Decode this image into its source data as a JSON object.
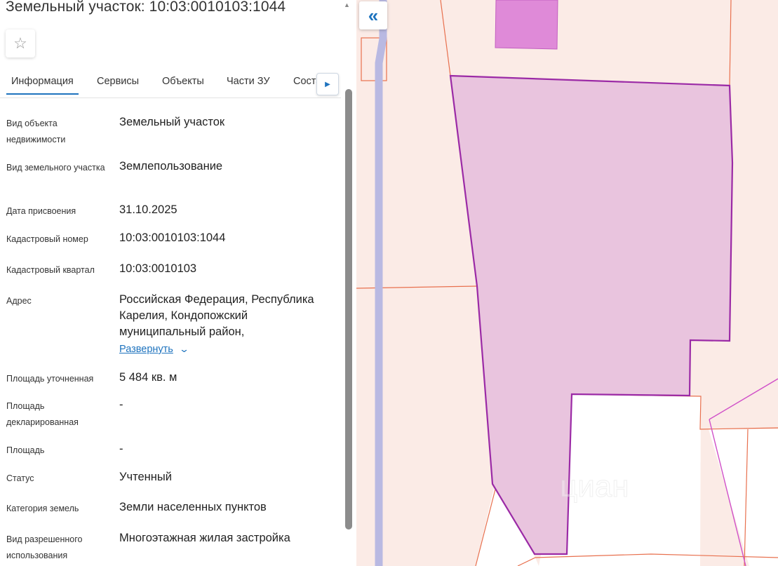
{
  "header": {
    "title": "Земельный участок: 10:03:0010103:1044"
  },
  "tabs": [
    {
      "label": "Информация",
      "active": true
    },
    {
      "label": "Сервисы"
    },
    {
      "label": "Объекты"
    },
    {
      "label": "Части ЗУ"
    },
    {
      "label": "Состав"
    }
  ],
  "fields": [
    {
      "label": "Вид объекта недвижимости",
      "value": "Земельный участок"
    },
    {
      "label": "Вид земельного участка",
      "value": "Землепользование"
    },
    {
      "label": "Дата присвоения",
      "value": "31.10.2025"
    },
    {
      "label": "Кадастровый номер",
      "value": "10:03:0010103:1044"
    },
    {
      "label": "Кадастровый квартал",
      "value": "10:03:0010103"
    },
    {
      "label": "Адрес",
      "value": "Российская Федерация, Республика Карелия, Кондопожский муниципальный район,"
    },
    {
      "label": "Площадь уточненная",
      "value": "5 484 кв. м"
    },
    {
      "label": "Площадь декларированная",
      "value": "-"
    },
    {
      "label": "Площадь",
      "value": "-"
    },
    {
      "label": "Статус",
      "value": "Учтенный"
    },
    {
      "label": "Категория земель",
      "value": "Земли населенных пунктов"
    },
    {
      "label": "Вид разрешенного использования",
      "value": "Многоэтажная жилая застройка"
    }
  ],
  "address_expand": {
    "label": "Развернуть"
  },
  "icons": {
    "favorite": "star-icon",
    "tab_scroll": "caret-right-icon",
    "collapse": "double-chevron-left-icon",
    "expand": "chevron-down-icon"
  },
  "map": {
    "watermark": "циан",
    "colors": {
      "background": "#fbebe6",
      "parcel_fill": "#e9c4de",
      "parcel_stroke": "#9b2aa6",
      "building_fill": "#df8ad8",
      "road": "#b9b9e2",
      "boundary": "#e8704e"
    }
  }
}
